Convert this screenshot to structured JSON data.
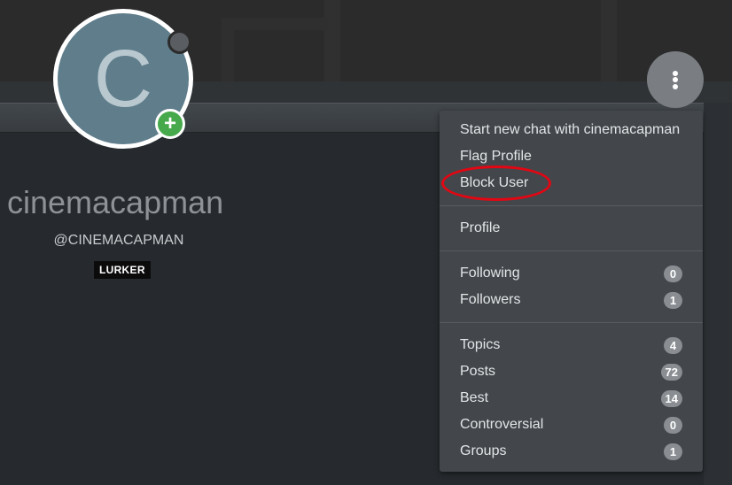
{
  "profile": {
    "avatar_letter": "C",
    "username": "cinemacapman",
    "handle": "@CINEMACAPMAN",
    "rank_badge": "LURKER"
  },
  "add_button_symbol": "+",
  "menu": {
    "actions": [
      {
        "label": "Start new chat with cinemacapman",
        "name": "menu-item-start-chat"
      },
      {
        "label": "Flag Profile",
        "name": "menu-item-flag-profile"
      },
      {
        "label": "Block User",
        "name": "menu-item-block-user"
      }
    ],
    "profile_label": "Profile",
    "social": [
      {
        "label": "Following",
        "count": "0"
      },
      {
        "label": "Followers",
        "count": "1"
      }
    ],
    "content": [
      {
        "label": "Topics",
        "count": "4"
      },
      {
        "label": "Posts",
        "count": "72"
      },
      {
        "label": "Best",
        "count": "14"
      },
      {
        "label": "Controversial",
        "count": "0"
      },
      {
        "label": "Groups",
        "count": "1"
      }
    ]
  },
  "icons": {
    "menu_button": "vertical-ellipsis-icon",
    "add": "plus-icon",
    "status": "status-dot-icon"
  },
  "colors": {
    "background": "#262a2e",
    "dropdown": "#43474b",
    "highlight_ring": "#e30613",
    "add_button": "#46a94b",
    "avatar_bg": "#5f7d8b"
  }
}
